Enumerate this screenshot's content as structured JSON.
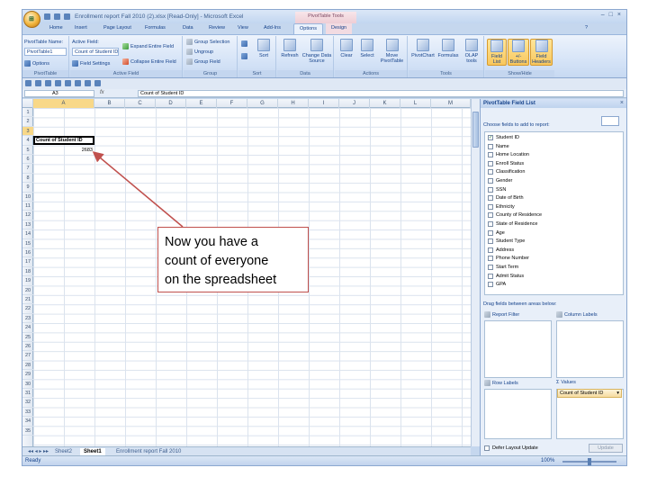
{
  "window": {
    "title": "Enrollment report Fall 2010 (2).xlsx [Read-Only] - Microsoft Excel",
    "context_tool": "PivotTable Tools",
    "controls": [
      "–",
      "□",
      "×"
    ]
  },
  "ribbon_tabs": [
    "Home",
    "Insert",
    "Page Layout",
    "Formulas",
    "Data",
    "Review",
    "View",
    "Add-Ins",
    "Options",
    "Design"
  ],
  "active_tab": "Options",
  "ribbon": {
    "pivottable": {
      "name_label": "PivotTable Name:",
      "name_value": "PivotTable1",
      "options_label": "Options",
      "group": "PivotTable"
    },
    "active_field": {
      "label": "Active Field:",
      "value": "Count of Student ID",
      "settings_label": "Field Settings",
      "expand": "Expand Entire Field",
      "collapse": "Collapse Entire Field",
      "group": "Active Field"
    },
    "group": {
      "selection": "Group Selection",
      "ungroup": "Ungroup",
      "field": "Group Field",
      "group": "Group"
    },
    "sort": {
      "label": "Sort",
      "group": "Sort"
    },
    "data": {
      "refresh": "Refresh",
      "change_source": "Change Data Source",
      "group": "Data"
    },
    "actions": {
      "clear": "Clear",
      "select": "Select",
      "move": "Move PivotTable",
      "group": "Actions"
    },
    "tools": {
      "pivotchart": "PivotChart",
      "formulas": "Formulas",
      "olap": "OLAP tools",
      "group": "Tools"
    },
    "show_hide": {
      "field_list": "Field List",
      "buttons": "+/- Buttons",
      "headers": "Field Headers",
      "group": "Show/Hide"
    }
  },
  "formula_bar": {
    "cell_ref": "A3",
    "fx": "fx",
    "content": "Count of Student ID"
  },
  "sheet": {
    "columns": [
      "A",
      "B",
      "C",
      "D",
      "E",
      "F",
      "G",
      "H",
      "I",
      "J",
      "K",
      "L",
      "M"
    ],
    "rows": [
      "1",
      "2",
      "3",
      "4",
      "5",
      "6",
      "7",
      "8",
      "9",
      "10",
      "11",
      "12",
      "13",
      "14",
      "15",
      "16",
      "17",
      "18",
      "19",
      "20",
      "21",
      "22",
      "23",
      "24",
      "25",
      "26",
      "27",
      "28",
      "29",
      "30",
      "31",
      "32",
      "33",
      "34",
      "35"
    ],
    "a3": "Count of Student ID",
    "a4": "2683"
  },
  "callout": {
    "line1": "Now you have a",
    "line2": "count of everyone",
    "line3": "on the spreadsheet"
  },
  "sheet_tabs": [
    "Sheet2",
    "Sheet1",
    "Enrollment report Fall 2010"
  ],
  "active_sheet": "Sheet1",
  "status": {
    "ready": "Ready",
    "zoom": "100%"
  },
  "field_list": {
    "title": "PivotTable Field List",
    "choose_label": "Choose fields to add to report:",
    "fields": [
      {
        "label": "Student ID",
        "checked": true
      },
      {
        "label": "Name",
        "checked": false
      },
      {
        "label": "Home Location",
        "checked": false
      },
      {
        "label": "Enroll Status",
        "checked": false
      },
      {
        "label": "Classification",
        "checked": false
      },
      {
        "label": "Gender",
        "checked": false
      },
      {
        "label": "SSN",
        "checked": false
      },
      {
        "label": "Date of Birth",
        "checked": false
      },
      {
        "label": "Ethnicity",
        "checked": false
      },
      {
        "label": "County of Residence",
        "checked": false
      },
      {
        "label": "State of Residence",
        "checked": false
      },
      {
        "label": "Age",
        "checked": false
      },
      {
        "label": "Student Type",
        "checked": false
      },
      {
        "label": "Address",
        "checked": false
      },
      {
        "label": "Phone Number",
        "checked": false
      },
      {
        "label": "Start Term",
        "checked": false
      },
      {
        "label": "Admit Status",
        "checked": false
      },
      {
        "label": "GPA",
        "checked": false
      }
    ],
    "drag_label": "Drag fields between areas below:",
    "areas": {
      "report_filter": "Report Filter",
      "column_labels": "Column Labels",
      "row_labels": "Row Labels",
      "values": "Values"
    },
    "values_field": "Count of Student ID",
    "defer_label": "Defer Layout Update",
    "update_button": "Update"
  }
}
